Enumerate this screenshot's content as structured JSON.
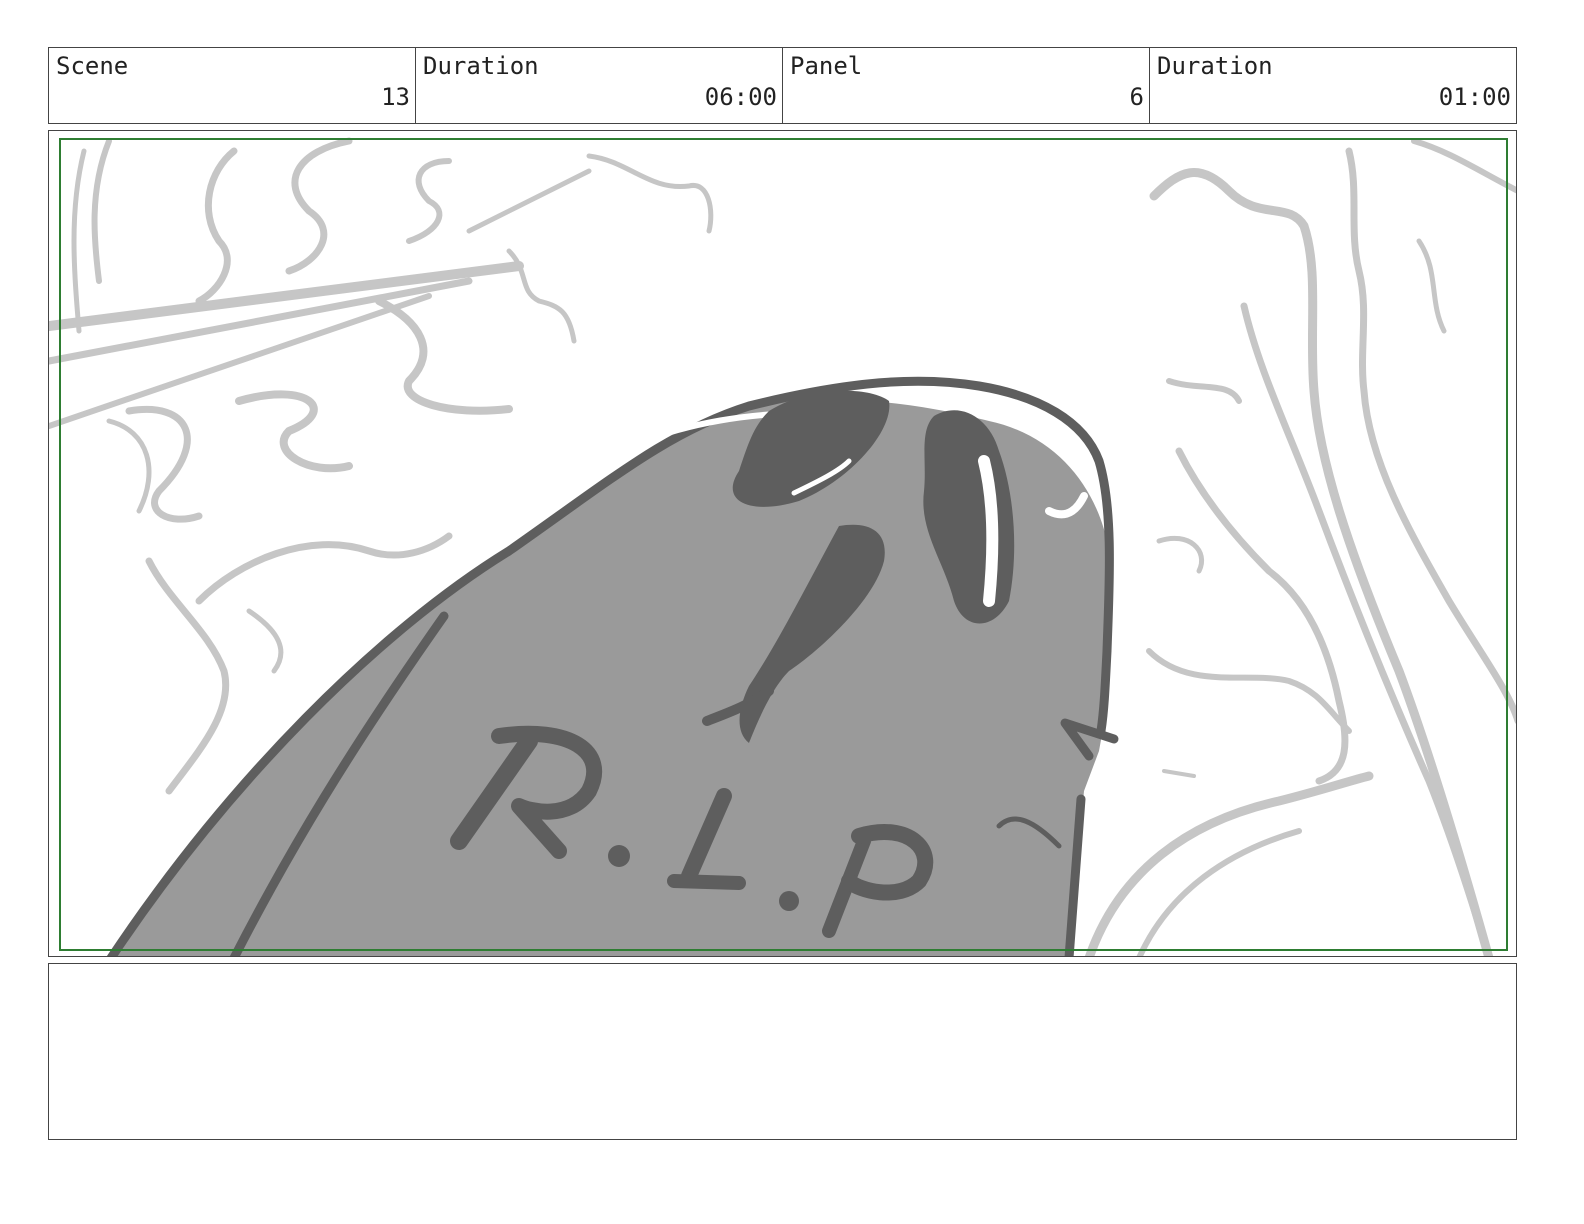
{
  "header": {
    "scene_label": "Scene",
    "scene_value": "13",
    "scene_duration_label": "Duration",
    "scene_duration_value": "06:00",
    "panel_label": "Panel",
    "panel_value": "6",
    "panel_duration_label": "Duration",
    "panel_duration_value": "01:00"
  },
  "panel": {
    "tombstone_inscription": "R.I.P",
    "safe_frame_color": "#2e7d32",
    "sketch_light_color": "#c6c6c6",
    "stone_fill_color": "#9a9a9a",
    "stone_line_color": "#5e5e5e"
  },
  "notes": {
    "text": ""
  }
}
